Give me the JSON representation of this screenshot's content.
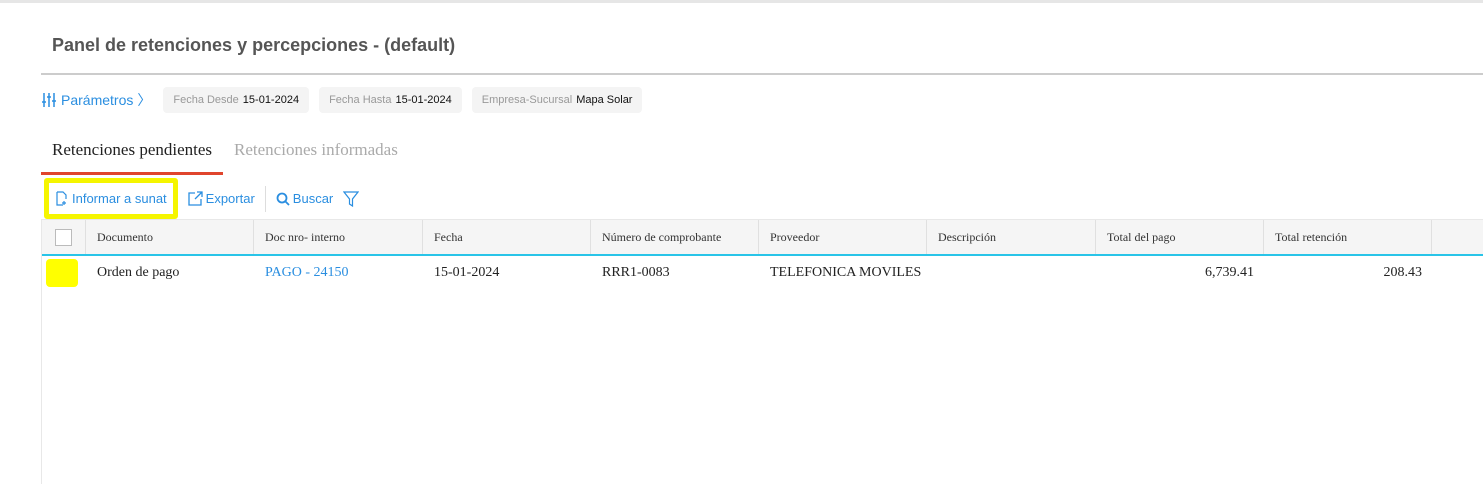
{
  "title": "Panel de retenciones y percepciones - (default)",
  "params": {
    "label": "Parámetros",
    "chips": [
      {
        "label": "Fecha Desde",
        "value": "15-01-2024"
      },
      {
        "label": "Fecha Hasta",
        "value": "15-01-2024"
      },
      {
        "label": "Empresa-Sucursal",
        "value": "Mapa Solar"
      }
    ]
  },
  "tabs": [
    "Retenciones pendientes",
    "Retenciones informadas"
  ],
  "toolbar": {
    "informar": "Informar a sunat",
    "exportar": "Exportar",
    "buscar": "Buscar"
  },
  "table": {
    "columns": [
      "Documento",
      "Doc nro- interno",
      "Fecha",
      "Número de comprobante",
      "Proveedor",
      "Descripción",
      "Total del pago",
      "Total retención"
    ],
    "rows": [
      {
        "documento": "Orden de pago",
        "doc": "PAGO - 24150",
        "fecha": "15-01-2024",
        "comprobante": "RRR1-0083",
        "proveedor": "TELEFONICA MOVILES",
        "descripcion": "",
        "total_pago": "6,739.41",
        "total_retencion": "208.43"
      }
    ]
  },
  "colors": {
    "accent": "#2a8ee0",
    "tab_underline": "#e0452d",
    "highlight": "#ffff00"
  }
}
